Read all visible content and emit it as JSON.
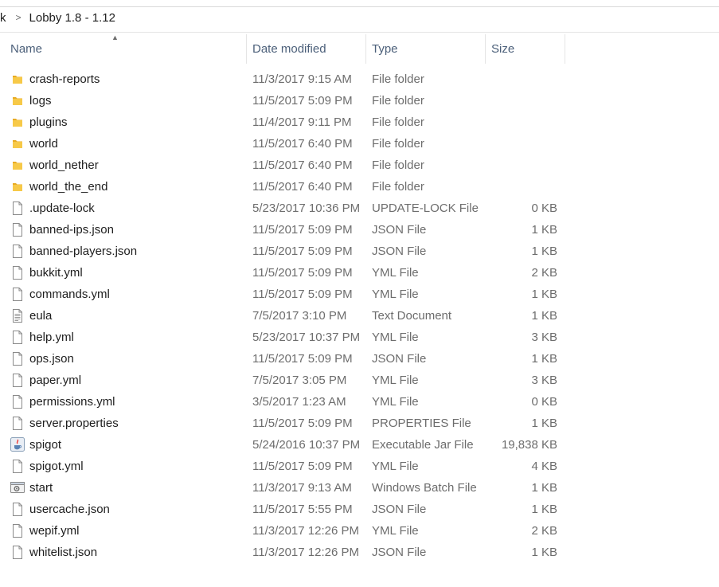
{
  "breadcrumb": {
    "prev": "k",
    "separator": ">",
    "current": "Lobby 1.8 - 1.12"
  },
  "columns": {
    "name": "Name",
    "date": "Date modified",
    "type": "Type",
    "size": "Size"
  },
  "files": [
    {
      "name": "crash-reports",
      "date": "11/3/2017 9:15 AM",
      "type": "File folder",
      "size": "",
      "icon": "folder-icon"
    },
    {
      "name": "logs",
      "date": "11/5/2017 5:09 PM",
      "type": "File folder",
      "size": "",
      "icon": "folder-icon"
    },
    {
      "name": "plugins",
      "date": "11/4/2017 9:11 PM",
      "type": "File folder",
      "size": "",
      "icon": "folder-icon"
    },
    {
      "name": "world",
      "date": "11/5/2017 6:40 PM",
      "type": "File folder",
      "size": "",
      "icon": "folder-icon"
    },
    {
      "name": "world_nether",
      "date": "11/5/2017 6:40 PM",
      "type": "File folder",
      "size": "",
      "icon": "folder-icon"
    },
    {
      "name": "world_the_end",
      "date": "11/5/2017 6:40 PM",
      "type": "File folder",
      "size": "",
      "icon": "folder-icon"
    },
    {
      "name": ".update-lock",
      "date": "5/23/2017 10:36 PM",
      "type": "UPDATE-LOCK File",
      "size": "0 KB",
      "icon": "file-icon"
    },
    {
      "name": "banned-ips.json",
      "date": "11/5/2017 5:09 PM",
      "type": "JSON File",
      "size": "1 KB",
      "icon": "file-icon"
    },
    {
      "name": "banned-players.json",
      "date": "11/5/2017 5:09 PM",
      "type": "JSON File",
      "size": "1 KB",
      "icon": "file-icon"
    },
    {
      "name": "bukkit.yml",
      "date": "11/5/2017 5:09 PM",
      "type": "YML File",
      "size": "2 KB",
      "icon": "file-icon"
    },
    {
      "name": "commands.yml",
      "date": "11/5/2017 5:09 PM",
      "type": "YML File",
      "size": "1 KB",
      "icon": "file-icon"
    },
    {
      "name": "eula",
      "date": "7/5/2017 3:10 PM",
      "type": "Text Document",
      "size": "1 KB",
      "icon": "text-document-icon"
    },
    {
      "name": "help.yml",
      "date": "5/23/2017 10:37 PM",
      "type": "YML File",
      "size": "3 KB",
      "icon": "file-icon"
    },
    {
      "name": "ops.json",
      "date": "11/5/2017 5:09 PM",
      "type": "JSON File",
      "size": "1 KB",
      "icon": "file-icon"
    },
    {
      "name": "paper.yml",
      "date": "7/5/2017 3:05 PM",
      "type": "YML File",
      "size": "3 KB",
      "icon": "file-icon"
    },
    {
      "name": "permissions.yml",
      "date": "3/5/2017 1:23 AM",
      "type": "YML File",
      "size": "0 KB",
      "icon": "file-icon"
    },
    {
      "name": "server.properties",
      "date": "11/5/2017 5:09 PM",
      "type": "PROPERTIES File",
      "size": "1 KB",
      "icon": "file-icon"
    },
    {
      "name": "spigot",
      "date": "5/24/2016 10:37 PM",
      "type": "Executable Jar File",
      "size": "19,838 KB",
      "icon": "java-jar-icon"
    },
    {
      "name": "spigot.yml",
      "date": "11/5/2017 5:09 PM",
      "type": "YML File",
      "size": "4 KB",
      "icon": "file-icon"
    },
    {
      "name": "start",
      "date": "11/3/2017 9:13 AM",
      "type": "Windows Batch File",
      "size": "1 KB",
      "icon": "batch-file-icon"
    },
    {
      "name": "usercache.json",
      "date": "11/5/2017 5:55 PM",
      "type": "JSON File",
      "size": "1 KB",
      "icon": "file-icon"
    },
    {
      "name": "wepif.yml",
      "date": "11/3/2017 12:26 PM",
      "type": "YML File",
      "size": "2 KB",
      "icon": "file-icon"
    },
    {
      "name": "whitelist.json",
      "date": "11/3/2017 12:26 PM",
      "type": "JSON File",
      "size": "1 KB",
      "icon": "file-icon"
    }
  ],
  "colors": {
    "folder": "#f4c33c",
    "header_text": "#4c607a",
    "meta_text": "#6d6d6d"
  }
}
